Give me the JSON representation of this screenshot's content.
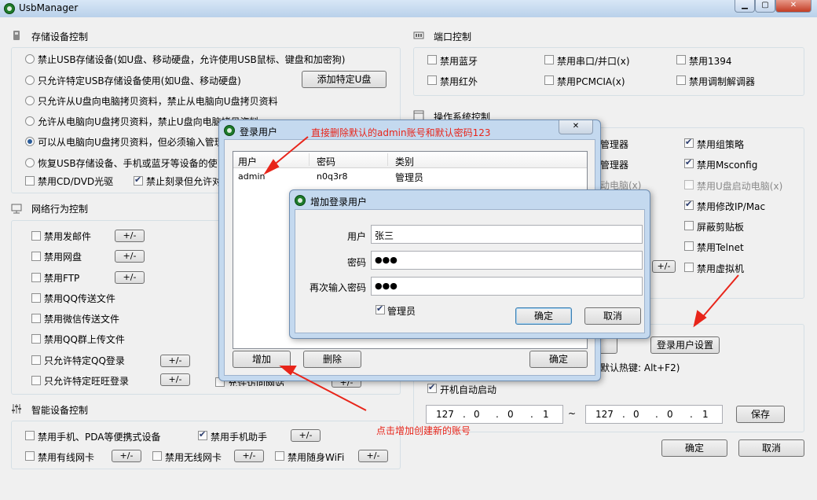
{
  "window": {
    "title": "UsbManager"
  },
  "storage": {
    "title": "存储设备控制",
    "radios": [
      {
        "label": "禁止USB存储设备(如U盘、移动硬盘，允许使用USB鼠标、键盘和加密狗)",
        "checked": false
      },
      {
        "label": "只允许特定USB存储设备使用(如U盘、移动硬盘)",
        "checked": false
      },
      {
        "label": "只允许从U盘向电脑拷贝资料，禁止从电脑向U盘拷贝资料",
        "checked": false
      },
      {
        "label": "允许从电脑向U盘拷贝资料，禁止U盘向电脑拷贝资料",
        "checked": false
      },
      {
        "label": "可以从电脑向U盘拷贝资料，但必须输入管理",
        "checked": true
      },
      {
        "label": "恢复USB存储设备、手机或蓝牙等设备的使",
        "checked": false
      }
    ],
    "add_usb_button": "添加特定U盘",
    "checks": [
      {
        "label": "禁用CD/DVD光驱",
        "checked": false
      },
      {
        "label": "禁止刻录但允许对",
        "checked": true
      }
    ]
  },
  "network": {
    "title": "网络行为控制",
    "items": [
      {
        "label": "禁用发邮件",
        "checked": false
      },
      {
        "label": "禁用网盘",
        "checked": false
      },
      {
        "label": "禁用FTP",
        "checked": false
      },
      {
        "label": "禁用QQ传送文件",
        "checked": false
      },
      {
        "label": "禁用微信传送文件",
        "checked": false
      },
      {
        "label": "禁用QQ群上传文件",
        "checked": false
      },
      {
        "label": "只允许特定QQ登录",
        "checked": false
      },
      {
        "label": "只允许特定旺旺登录",
        "checked": false
      }
    ],
    "plus_minus": "+/-",
    "partial_label": "允许访问网站"
  },
  "smart": {
    "title": "智能设备控制",
    "items": [
      {
        "label": "禁用手机、PDA等便携式设备",
        "checked": false
      },
      {
        "label": "禁用手机助手",
        "checked": true
      },
      {
        "label": "禁用有线网卡",
        "checked": false
      },
      {
        "label": "禁用无线网卡",
        "checked": false
      },
      {
        "label": "禁用随身WiFi",
        "checked": false
      }
    ]
  },
  "port": {
    "title": "端口控制",
    "items": [
      {
        "label": "禁用蓝牙",
        "checked": false
      },
      {
        "label": "禁用串口/并口(x)",
        "checked": false
      },
      {
        "label": "禁用1394",
        "checked": false
      },
      {
        "label": "禁用红外",
        "checked": false
      },
      {
        "label": "禁用PCMCIA(x)",
        "checked": false
      },
      {
        "label": "禁用调制解调器",
        "checked": false
      }
    ]
  },
  "os": {
    "title": "操作系统控制",
    "left_partial": [
      "管理器",
      "管理器",
      "动电脑(x)"
    ],
    "items": [
      {
        "label": "禁用组策略",
        "checked": true,
        "dim": false
      },
      {
        "label": "禁用Msconfig",
        "checked": true,
        "dim": false
      },
      {
        "label": "禁用U盘启动电脑(x)",
        "checked": false,
        "dim": true
      },
      {
        "label": "禁用修改IP/Mac",
        "checked": true,
        "dim": false
      },
      {
        "label": "屏蔽剪贴板",
        "checked": false,
        "dim": false
      },
      {
        "label": "禁用Telnet",
        "checked": false,
        "dim": false
      },
      {
        "label": "禁用虚拟机",
        "checked": false,
        "dim": false
      }
    ]
  },
  "other": {
    "login_settings_button": "登录用户设置",
    "hotkey_text": "默认热键: Alt+F2)",
    "autostart_label": "开机自动启动",
    "autostart_checked": true,
    "ip_start": [
      "127",
      "0",
      "0",
      "1"
    ],
    "ip_end": [
      "127",
      "0",
      "0",
      "1"
    ],
    "range_sep": "~",
    "save_button": "保存",
    "ok_button": "确定",
    "cancel_button": "取消"
  },
  "login_dialog": {
    "title": "登录用户",
    "columns": [
      "用户",
      "密码",
      "类别"
    ],
    "rows": [
      {
        "user": "admin",
        "password": "n0q3r8",
        "type": "管理员"
      }
    ],
    "add_button": "增加",
    "delete_button": "删除",
    "ok_button": "确定"
  },
  "add_dialog": {
    "title": "增加登录用户",
    "user_label": "用户",
    "user_value": "张三",
    "password_label": "密码",
    "password_value": "●●●",
    "confirm_label": "再次输入密码",
    "confirm_value": "●●●",
    "admin_label": "管理员",
    "admin_checked": true,
    "ok_button": "确定",
    "cancel_button": "取消"
  },
  "annotations": {
    "top": "直接删除默认的admin账号和默认密码123",
    "bottom": "点击增加创建新的账号",
    "color": "#e8251a"
  }
}
